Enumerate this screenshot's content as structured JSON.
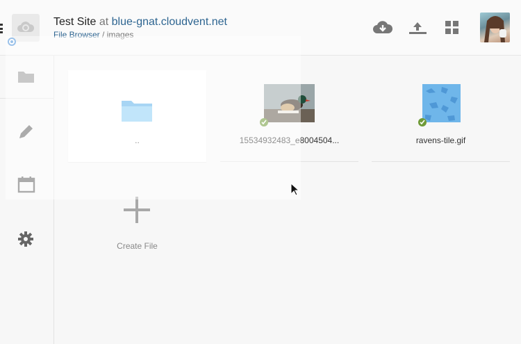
{
  "header": {
    "site_name": "Test Site",
    "at_word": "at",
    "domain": "blue-gnat.cloudvent.net",
    "breadcrumb_link": "File Browser",
    "breadcrumb_separator": "/",
    "breadcrumb_current": "images"
  },
  "header_icons": [
    "cloud-download-icon",
    "upload-icon",
    "grid-view-icon",
    "avatar"
  ],
  "sidebar": {
    "items": [
      {
        "icon": "folder-icon"
      },
      {
        "icon": "pencil-icon"
      },
      {
        "icon": "calendar-icon"
      },
      {
        "icon": "gear-icon"
      }
    ]
  },
  "files": [
    {
      "label": "..",
      "kind": "parent-folder"
    },
    {
      "label": "15534932483_e8004504...",
      "kind": "image",
      "synced": true
    },
    {
      "label": "ravens-tile.gif",
      "kind": "image",
      "synced": true
    }
  ],
  "create_file": {
    "label": "Create File"
  },
  "colors": {
    "accent_link": "#2e6591",
    "folder_blue": "#7dc3f3",
    "sync_green": "#6f9a37",
    "icon_gray": "#777777"
  }
}
